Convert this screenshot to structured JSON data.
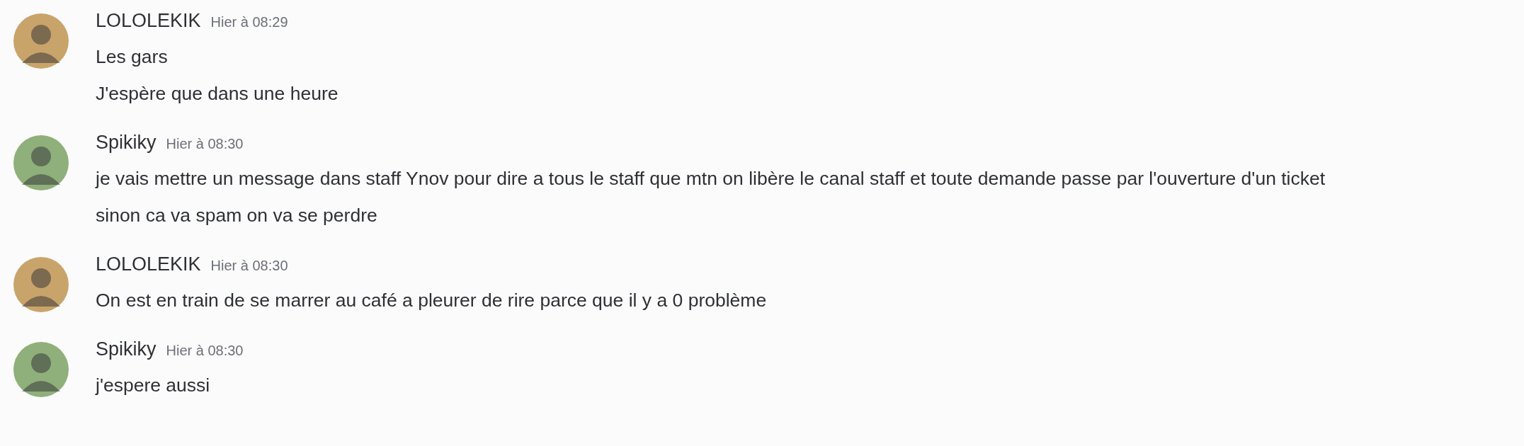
{
  "messages": [
    {
      "author": "LOLOLEKIK",
      "time": "Hier à 08:29",
      "avatar": {
        "color": "#c9a46a"
      },
      "lines": [
        "Les gars",
        "J'espère que dans une heure"
      ]
    },
    {
      "author": "Spikiky",
      "time": "Hier à 08:30",
      "avatar": {
        "color": "#8fb07a"
      },
      "lines": [
        "je vais mettre un message dans staff Ynov pour dire a tous le staff que mtn on libère le canal staff et toute demande passe par l'ouverture d'un ticket",
        "sinon ca va spam on va se perdre"
      ]
    },
    {
      "author": "LOLOLEKIK",
      "time": "Hier à 08:30",
      "avatar": {
        "color": "#c9a46a"
      },
      "lines": [
        "On est en train de se marrer au café a pleurer de rire parce que il y a 0 problème"
      ]
    },
    {
      "author": "Spikiky",
      "time": "Hier à 08:30",
      "avatar": {
        "color": "#8fb07a"
      },
      "lines": [
        "j'espere aussi"
      ]
    }
  ]
}
